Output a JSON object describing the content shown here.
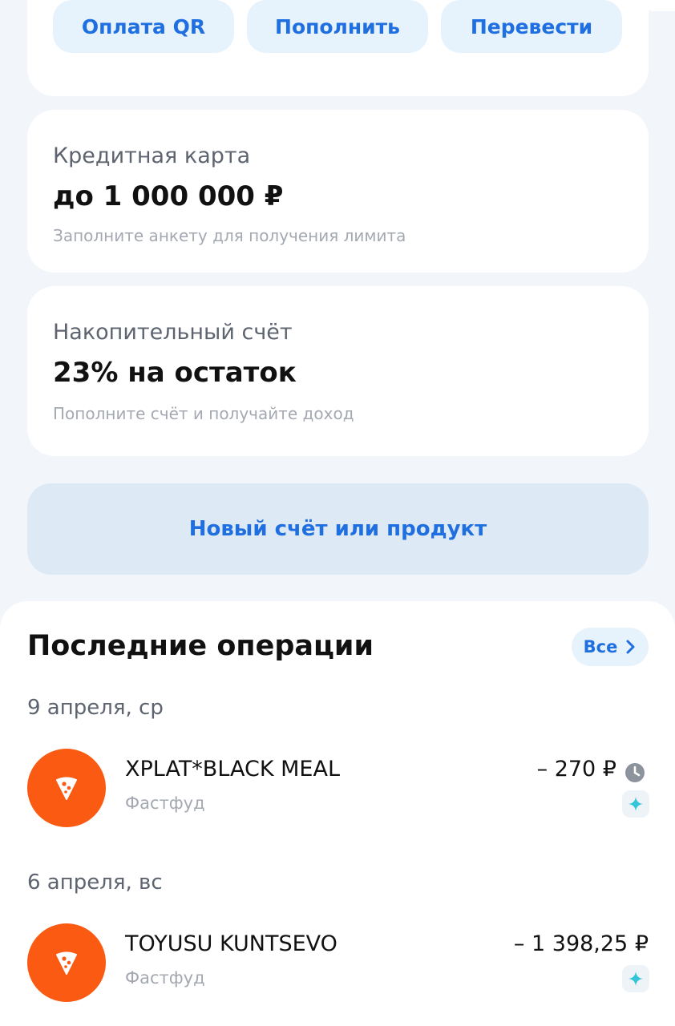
{
  "quick_actions": {
    "pay_qr": "Оплата QR",
    "top_up": "Пополнить",
    "transfer": "Перевести"
  },
  "credit_card": {
    "title": "Кредитная карта",
    "value": "до 1 000 000 ₽",
    "hint": "Заполните анкету для получения лимита"
  },
  "savings": {
    "title": "Накопительный счёт",
    "value": "23% на остаток",
    "hint": "Пополните счёт и получайте доход"
  },
  "new_product": {
    "label": "Новый счёт или продукт"
  },
  "operations": {
    "title": "Последние операции",
    "all_label": "Все",
    "groups": [
      {
        "date": "9 апреля, ср",
        "items": [
          {
            "name": "XPLAT*BLACK MEAL",
            "category": "Фастфуд",
            "amount": "– 270 ₽",
            "icon": "pizza-icon",
            "status_icon": "clock-icon"
          }
        ]
      },
      {
        "date": "6 апреля, вс",
        "items": [
          {
            "name": "TOYUSU KUNTSEVO",
            "category": "Фастфуд",
            "amount": "– 1 398,25 ₽",
            "icon": "pizza-icon"
          }
        ]
      }
    ]
  },
  "colors": {
    "accent": "#1f6fe0",
    "category_orange": "#fb5a12",
    "sparkle": "#35c5d8",
    "background": "#f2f5f9"
  }
}
